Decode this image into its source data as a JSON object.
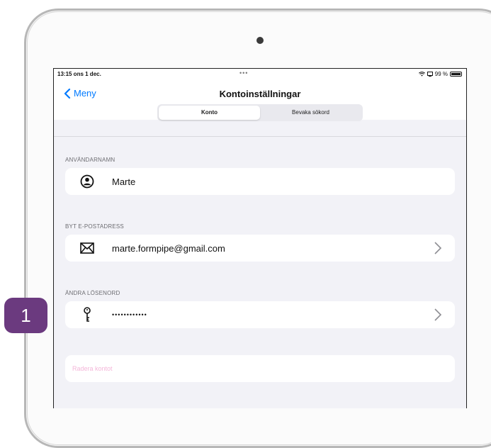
{
  "statusbar": {
    "time": "13:15  ons 1 dec.",
    "dots": "•••",
    "battery": "99 %"
  },
  "nav": {
    "back_label": "Meny",
    "title": "Kontoinställningar"
  },
  "tabs": [
    {
      "label": "Konto",
      "active": true
    },
    {
      "label": "Bevaka sökord",
      "active": false
    }
  ],
  "sections": {
    "username_header": "ANVÄNDARNAMN",
    "username_value": "Marte",
    "email_header": "BYT E-POSTADRESS",
    "email_value": "marte.formpipe@gmail.com",
    "password_header": "ÄNDRA LÖSENORD",
    "password_value": "••••••••••••",
    "delete_label": "Radera kontot"
  },
  "callout": {
    "number": "1",
    "color": "#6b3a7f"
  },
  "colors": {
    "accent": "#007aff",
    "danger_text": "#f4b6d9",
    "background": "#f2f2f7"
  },
  "icons": [
    "chevron-left-icon",
    "wifi-icon",
    "screen-icon",
    "battery-icon",
    "person-circle-icon",
    "envelope-icon",
    "key-icon",
    "chevron-right-icon"
  ]
}
